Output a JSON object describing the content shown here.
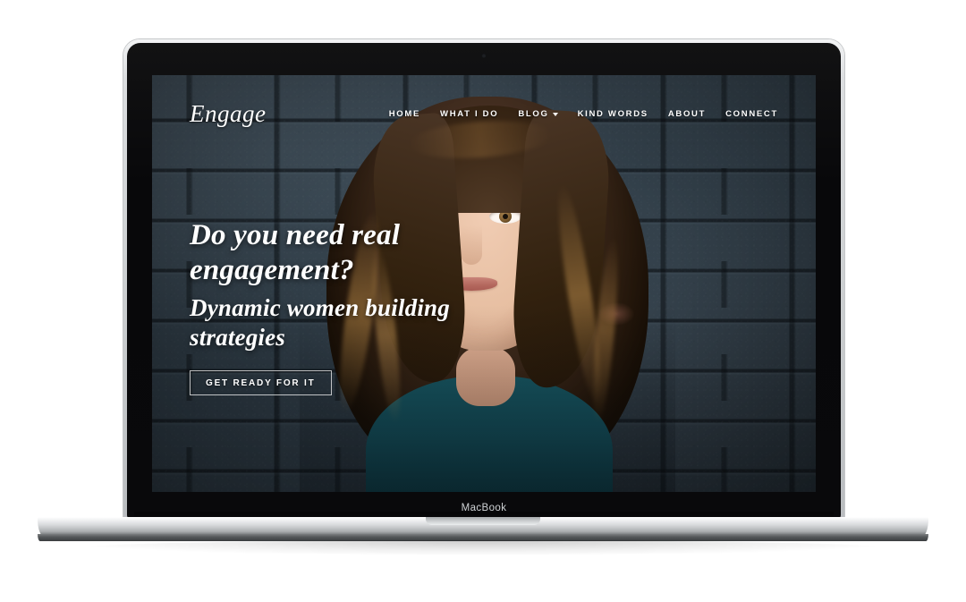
{
  "device": {
    "brand_label": "MacBook",
    "webcam_icon": "webcam-dot-icon"
  },
  "site": {
    "logo": "Engage",
    "nav": [
      {
        "label": "HOME",
        "has_dropdown": false
      },
      {
        "label": "WHAT I DO",
        "has_dropdown": false
      },
      {
        "label": "BLOG",
        "has_dropdown": true
      },
      {
        "label": "KIND WORDS",
        "has_dropdown": false
      },
      {
        "label": "ABOUT",
        "has_dropdown": false
      },
      {
        "label": "CONNECT",
        "has_dropdown": false
      }
    ],
    "hero": {
      "headline": "Do you need real engagement?",
      "subheadline": "Dynamic women building strategies",
      "cta_label": "GET READY FOR IT"
    },
    "colors": {
      "text": "#ffffff",
      "wall": "#33414c",
      "top": "#14505a",
      "cta_border": "#ffffff"
    }
  }
}
